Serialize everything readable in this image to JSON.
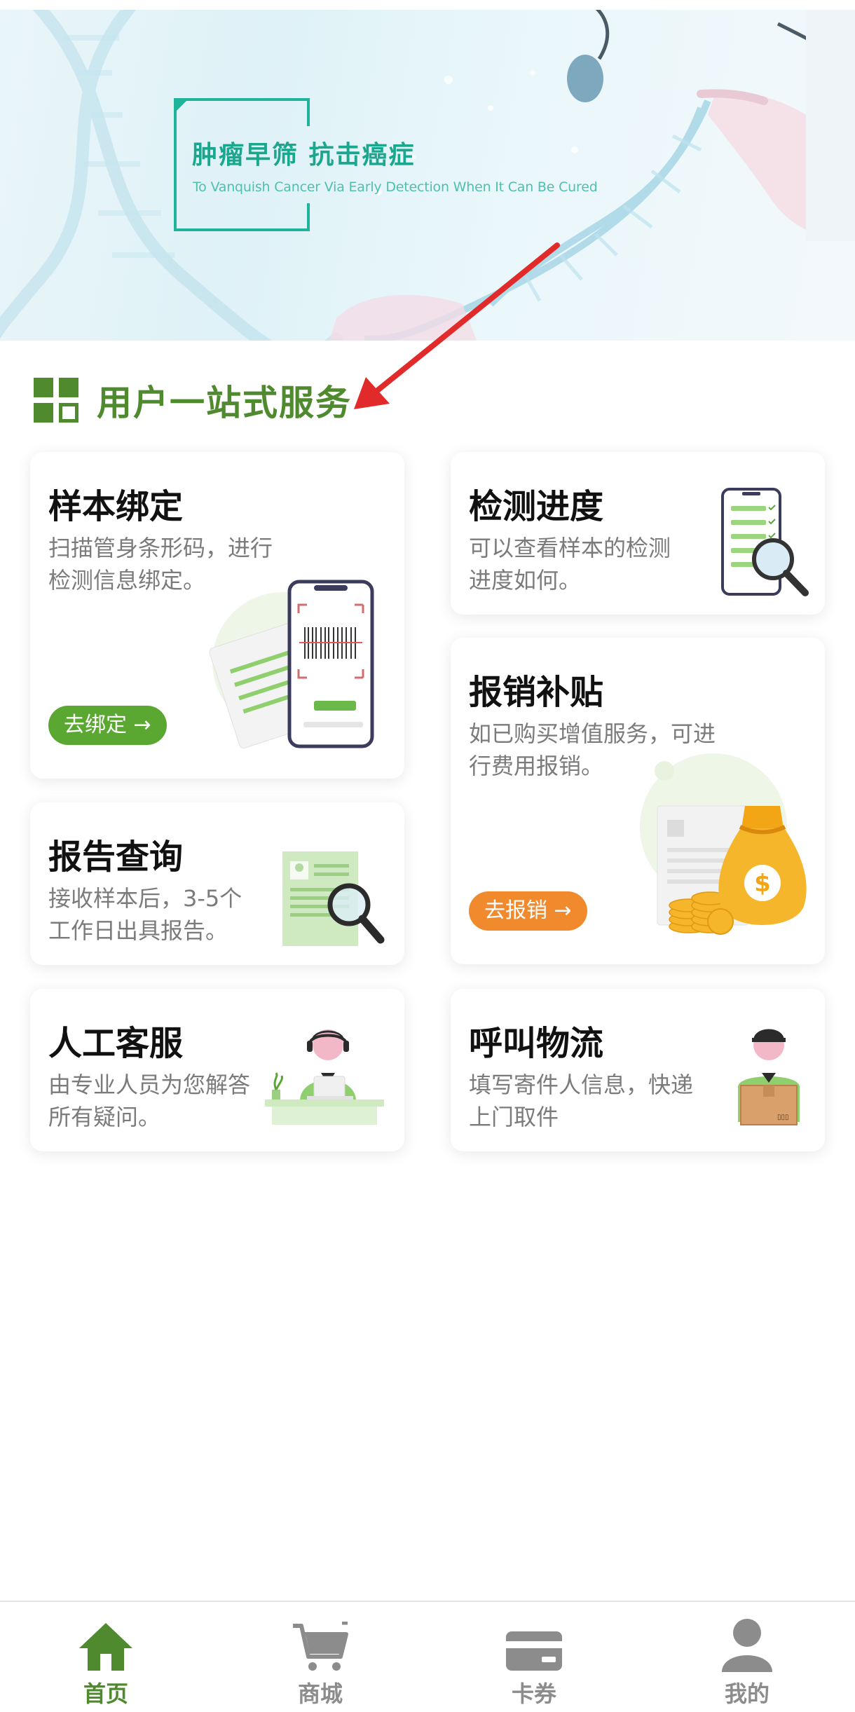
{
  "banner": {
    "title": "肿瘤早筛  抗击癌症",
    "subtitle": "To Vanquish Cancer Via Early Detection When It Can Be Cured"
  },
  "section": {
    "title": "用户一站式服务",
    "icon": "grid-icon"
  },
  "cards": {
    "sample_bind": {
      "title": "样本绑定",
      "desc": "扫描管身条形码，进行\n检测信息绑定。",
      "button": "去绑定 →",
      "icon": "barcode-phone-icon"
    },
    "progress": {
      "title": "检测进度",
      "desc": "可以查看样本的检测\n进度如何。",
      "icon": "phone-magnifier-icon"
    },
    "reimburse": {
      "title": "报销补贴",
      "desc": "如已购买增值服务，可进\n行费用报销。",
      "button": "去报销 →",
      "icon": "money-bag-icon"
    },
    "report": {
      "title": "报告查询",
      "desc": "接收样本后，3-5个\n工作日出具报告。",
      "icon": "report-magnifier-icon"
    },
    "service": {
      "title": "人工客服",
      "desc": "由专业人员为您解答\n所有疑问。",
      "icon": "customer-service-icon"
    },
    "logistics": {
      "title": "呼叫物流",
      "desc": "填写寄件人信息，快递\n上门取件",
      "icon": "courier-icon"
    }
  },
  "tabbar": {
    "items": [
      {
        "label": "首页",
        "icon": "home-icon",
        "active": true
      },
      {
        "label": "商城",
        "icon": "cart-icon",
        "active": false
      },
      {
        "label": "卡券",
        "icon": "card-icon",
        "active": false
      },
      {
        "label": "我的",
        "icon": "user-icon",
        "active": false
      }
    ]
  },
  "colors": {
    "brand_green": "#4f8a2e",
    "button_green": "#5aa832",
    "button_orange": "#f08a2c",
    "banner_teal": "#1aa78e",
    "tab_inactive": "#8c8c8c"
  }
}
